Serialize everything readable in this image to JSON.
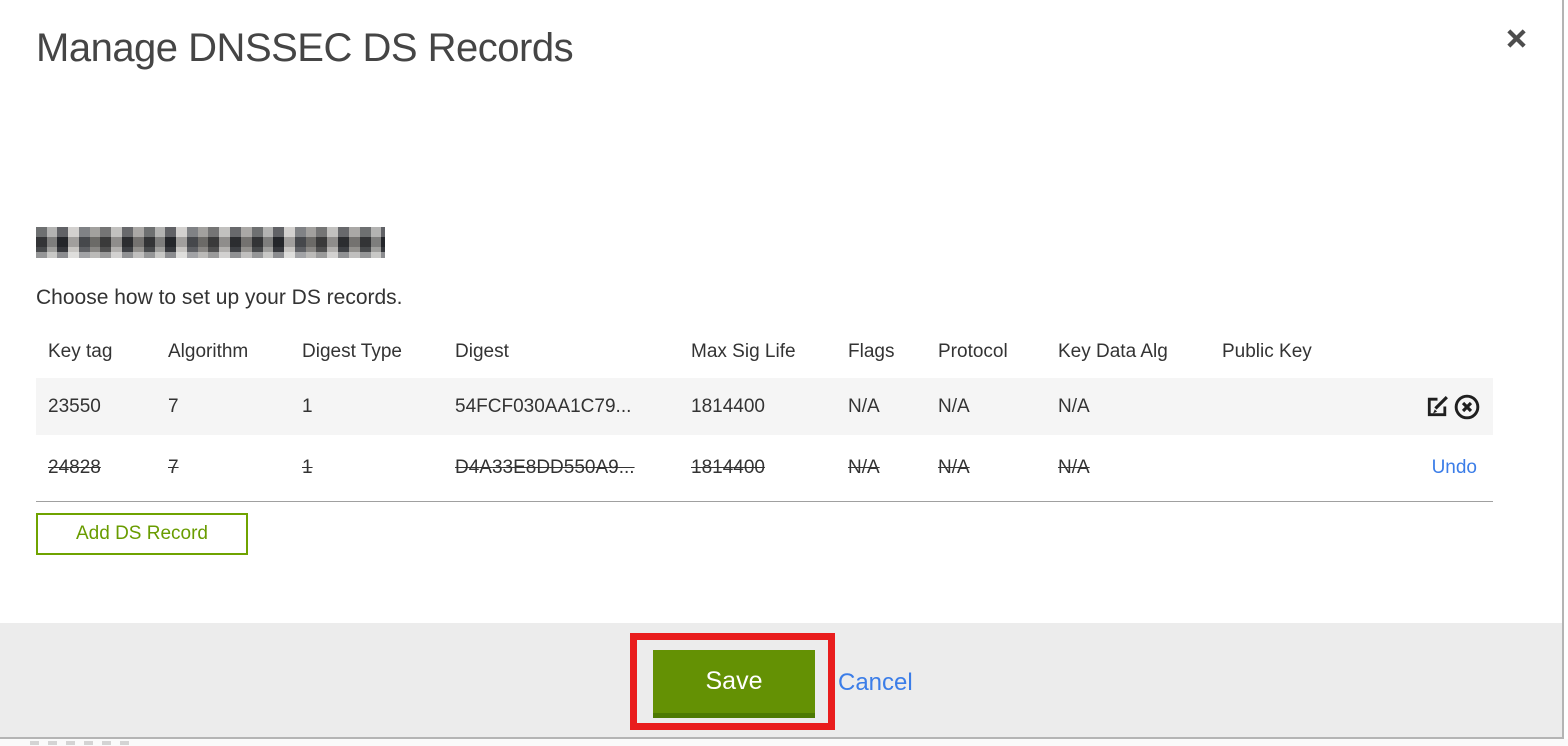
{
  "header": {
    "title": "Manage DNSSEC DS Records"
  },
  "domain": {
    "redacted": true
  },
  "instruction": "Choose how to set up your DS records.",
  "table": {
    "columns": [
      "Key tag",
      "Algorithm",
      "Digest Type",
      "Digest",
      "Max Sig Life",
      "Flags",
      "Protocol",
      "Key Data Alg",
      "Public Key"
    ],
    "rows": [
      {
        "cells": [
          "23550",
          "7",
          "1",
          "54FCF030AA1C79...",
          "1814400",
          "N/A",
          "N/A",
          "N/A",
          ""
        ],
        "deleted": false
      },
      {
        "cells": [
          "24828",
          "7",
          "1",
          "D4A33E8DD550A9...",
          "1814400",
          "N/A",
          "N/A",
          "N/A",
          ""
        ],
        "deleted": true,
        "undo_label": "Undo"
      }
    ]
  },
  "buttons": {
    "add_ds_record": "Add DS Record",
    "save": "Save",
    "cancel": "Cancel"
  },
  "icons": {
    "close": "close-x",
    "edit": "pencil-square",
    "delete": "circle-x"
  },
  "colors": {
    "save_green": "#649104",
    "green_outline": "#6fa300",
    "green_text": "#699c00",
    "link_blue": "#3b7de8",
    "annotation_red": "#e91d1d",
    "row_highlight": "#f5f5f5",
    "footer_bg": "#ececec"
  }
}
